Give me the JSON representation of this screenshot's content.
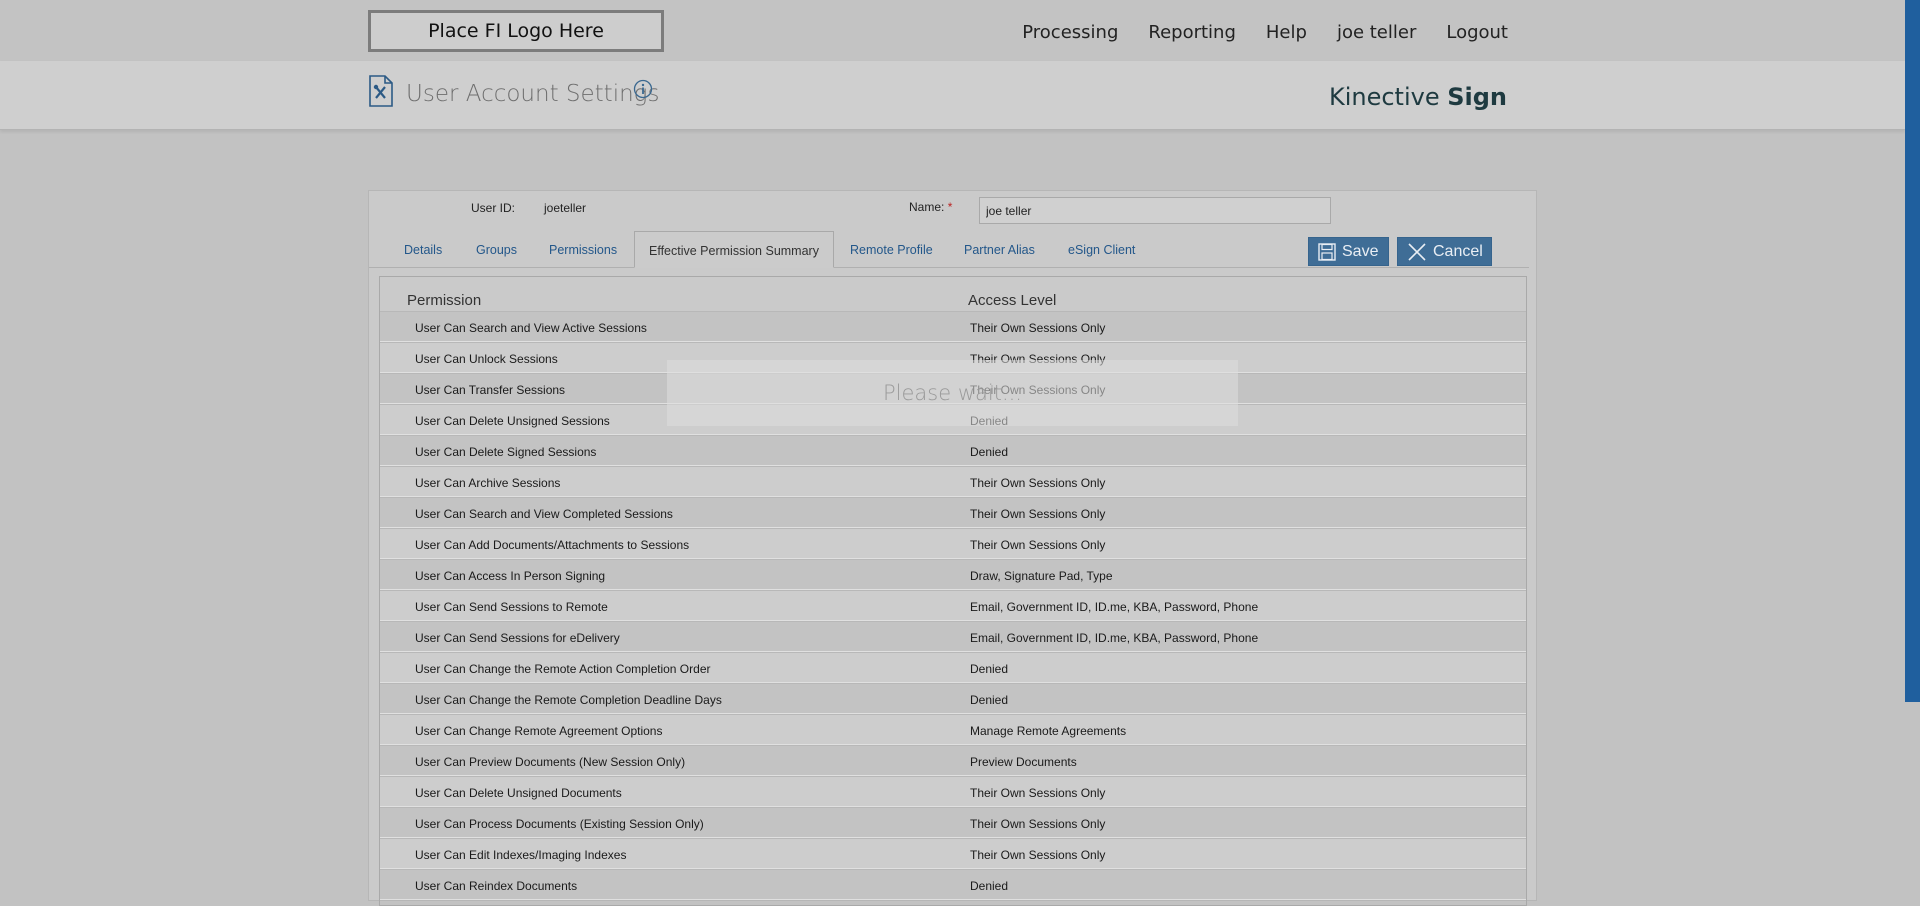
{
  "header": {
    "logo_text": "Place FI Logo Here",
    "nav": [
      "Processing",
      "Reporting",
      "Help",
      "joe teller",
      "Logout"
    ],
    "page_title": "User Account Settings",
    "brand_light": "Kinective",
    "brand_bold": "Sign"
  },
  "form": {
    "user_id_label": "User ID:",
    "user_id_value": "joeteller",
    "name_label": "Name:",
    "name_required_mark": "*",
    "name_value": "joe teller"
  },
  "tabs": [
    "Details",
    "Groups",
    "Permissions",
    "Effective Permission Summary",
    "Remote Profile",
    "Partner Alias",
    "eSign Client"
  ],
  "buttons": {
    "save": "Save",
    "cancel": "Cancel"
  },
  "table": {
    "headers": [
      "Permission",
      "Access Level"
    ],
    "rows": [
      [
        "User Can Search and View Active Sessions",
        "Their Own Sessions Only"
      ],
      [
        "User Can Unlock Sessions",
        "Their Own Sessions Only"
      ],
      [
        "User Can Transfer Sessions",
        "Their Own Sessions Only"
      ],
      [
        "User Can Delete Unsigned Sessions",
        "Denied"
      ],
      [
        "User Can Delete Signed Sessions",
        "Denied"
      ],
      [
        "User Can Archive Sessions",
        "Their Own Sessions Only"
      ],
      [
        "User Can Search and View Completed Sessions",
        "Their Own Sessions Only"
      ],
      [
        "User Can Add Documents/Attachments to Sessions",
        "Their Own Sessions Only"
      ],
      [
        "User Can Access In Person Signing",
        "Draw, Signature Pad, Type"
      ],
      [
        "User Can Send Sessions to Remote",
        "Email, Government ID, ID.me, KBA, Password, Phone"
      ],
      [
        "User Can Send Sessions for eDelivery",
        "Email, Government ID, ID.me, KBA, Password, Phone"
      ],
      [
        "User Can Change the Remote Action Completion Order",
        "Denied"
      ],
      [
        "User Can Change the Remote Completion Deadline Days",
        "Denied"
      ],
      [
        "User Can Change Remote Agreement Options",
        "Manage Remote Agreements"
      ],
      [
        "User Can Preview Documents (New Session Only)",
        "Preview Documents"
      ],
      [
        "User Can Delete Unsigned Documents",
        "Their Own Sessions Only"
      ],
      [
        "User Can Process Documents (Existing Session Only)",
        "Their Own Sessions Only"
      ],
      [
        "User Can Edit Indexes/Imaging Indexes",
        "Their Own Sessions Only"
      ],
      [
        "User Can Reindex Documents",
        "Denied"
      ]
    ]
  },
  "overlay": {
    "text": "Please wait..."
  },
  "colors": {
    "accent": "#1f5f9e",
    "button": "#3f6d96",
    "link": "#23578a"
  }
}
